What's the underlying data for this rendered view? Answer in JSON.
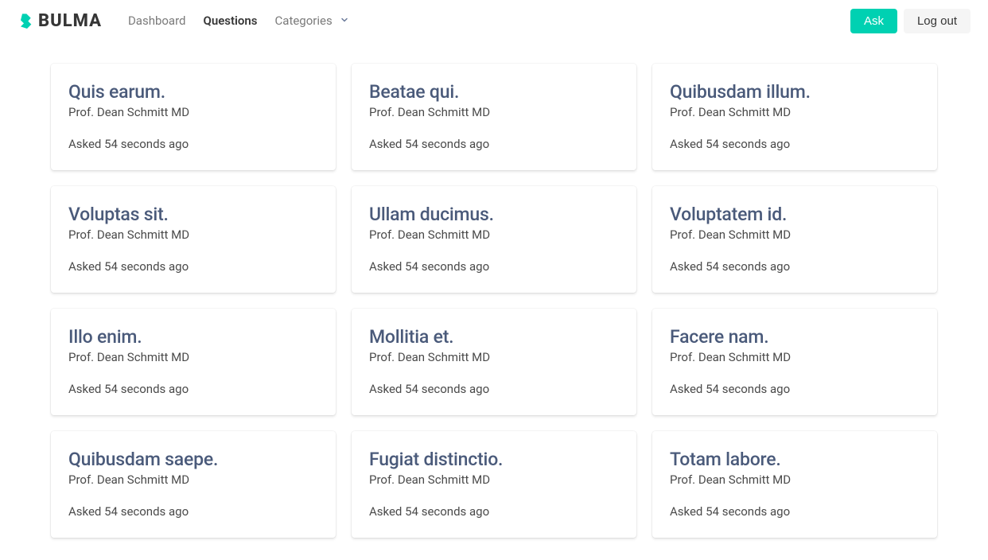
{
  "brand": {
    "text": "BULMA"
  },
  "nav": {
    "dashboard": "Dashboard",
    "questions": "Questions",
    "categories": "Categories"
  },
  "actions": {
    "ask": "Ask",
    "logout": "Log out"
  },
  "questions": [
    {
      "title": "Quis earum.",
      "author": "Prof. Dean Schmitt MD",
      "time": "Asked 54 seconds ago"
    },
    {
      "title": "Beatae qui.",
      "author": "Prof. Dean Schmitt MD",
      "time": "Asked 54 seconds ago"
    },
    {
      "title": "Quibusdam illum.",
      "author": "Prof. Dean Schmitt MD",
      "time": "Asked 54 seconds ago"
    },
    {
      "title": "Voluptas sit.",
      "author": "Prof. Dean Schmitt MD",
      "time": "Asked 54 seconds ago"
    },
    {
      "title": "Ullam ducimus.",
      "author": "Prof. Dean Schmitt MD",
      "time": "Asked 54 seconds ago"
    },
    {
      "title": "Voluptatem id.",
      "author": "Prof. Dean Schmitt MD",
      "time": "Asked 54 seconds ago"
    },
    {
      "title": "Illo enim.",
      "author": "Prof. Dean Schmitt MD",
      "time": "Asked 54 seconds ago"
    },
    {
      "title": "Mollitia et.",
      "author": "Prof. Dean Schmitt MD",
      "time": "Asked 54 seconds ago"
    },
    {
      "title": "Facere nam.",
      "author": "Prof. Dean Schmitt MD",
      "time": "Asked 54 seconds ago"
    },
    {
      "title": "Quibusdam saepe.",
      "author": "Prof. Dean Schmitt MD",
      "time": "Asked 54 seconds ago"
    },
    {
      "title": "Fugiat distinctio.",
      "author": "Prof. Dean Schmitt MD",
      "time": "Asked 54 seconds ago"
    },
    {
      "title": "Totam labore.",
      "author": "Prof. Dean Schmitt MD",
      "time": "Asked 54 seconds ago"
    }
  ]
}
